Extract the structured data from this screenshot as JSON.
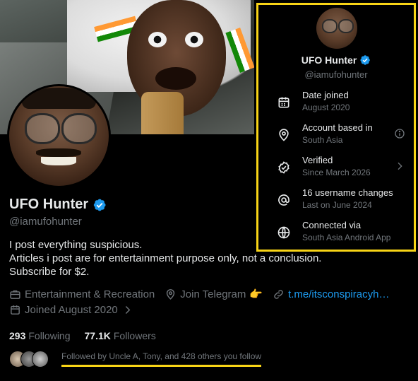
{
  "profile": {
    "name": "UFO Hunter",
    "handle": "@iamufohunter",
    "bio": [
      "I post everything suspicious.",
      "Articles i post are for entertainment purpose only, not a conclusion.",
      "Subscribe for $2."
    ],
    "category": "Entertainment & Recreation",
    "location": "Join Telegram",
    "location_emoji": "👉",
    "website": "t.me/itsconspiracyh…",
    "joined": "Joined August 2020",
    "following_count": "293",
    "following_label": "Following",
    "followers_count": "77.1K",
    "followers_label": "Followers",
    "followed_by": "Followed by Uncle A, Tony, and 428 others you follow"
  },
  "about_panel": {
    "name": "UFO Hunter",
    "handle": "@iamufohunter",
    "rows": [
      {
        "icon": "calendar-icon",
        "title": "Date joined",
        "subtitle": "August 2020"
      },
      {
        "icon": "location-pin-icon",
        "title": "Account based in",
        "subtitle": "South Asia",
        "trailing": "info-icon"
      },
      {
        "icon": "verified-badge-icon",
        "title": "Verified",
        "subtitle": "Since March 2026",
        "trailing": "chevron-right-icon"
      },
      {
        "icon": "at-sign-icon",
        "title": "16 username changes",
        "subtitle": "Last on June 2024"
      },
      {
        "icon": "globe-icon",
        "title": "Connected via",
        "subtitle": "South Asia Android App"
      }
    ]
  },
  "colors": {
    "background": "#000000",
    "primary_text": "#e7e9ea",
    "secondary_text": "#71767b",
    "link": "#1d9bf0",
    "verified": "#1d9bf0",
    "highlight": "#f8d416"
  }
}
